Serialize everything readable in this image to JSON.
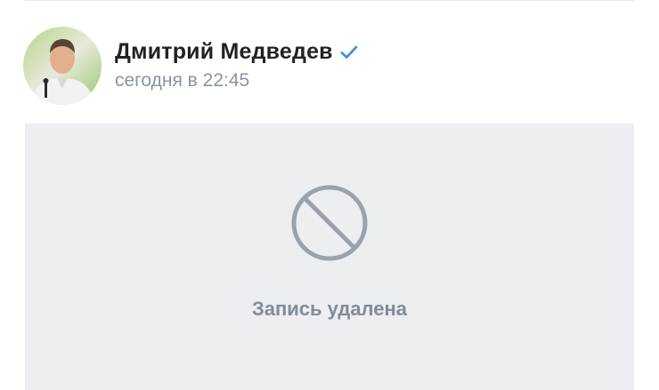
{
  "post": {
    "author_name": "Дмитрий Медведев",
    "verified_icon": "verified-check-icon",
    "time": "сегодня в 22:45",
    "deleted_icon": "prohibited-icon",
    "deleted_text": "Запись удалена"
  },
  "colors": {
    "verified": "#4a8fd4",
    "time_text": "#8a93a0",
    "deleted_bg": "#eceef1",
    "deleted_icon": "#99a2ad",
    "deleted_text": "#818c99"
  }
}
